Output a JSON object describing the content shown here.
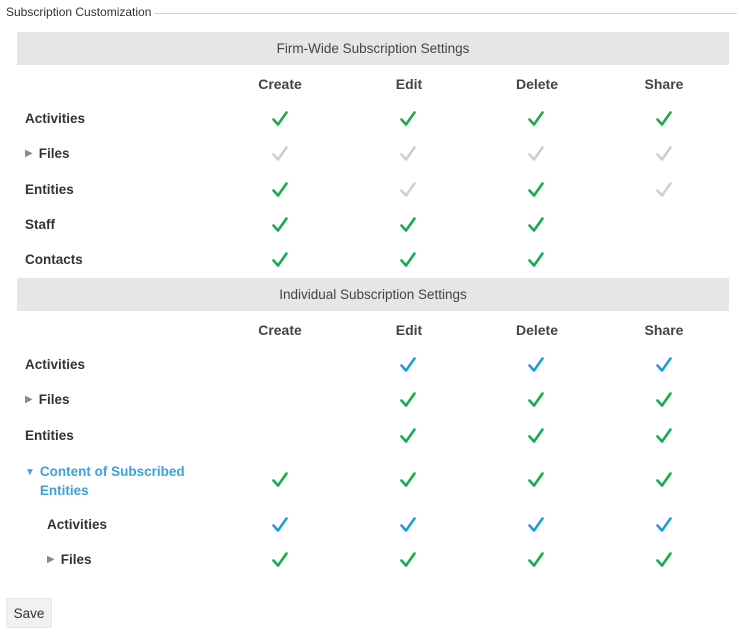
{
  "fieldset_title": "Subscription Customization",
  "colors": {
    "green": "#1aaa4e",
    "gray": "#d0d0d0",
    "blue": "#1a9ee0",
    "link": "#3aa3d9"
  },
  "firm": {
    "title": "Firm-Wide Subscription Settings",
    "headers": {
      "create": "Create",
      "edit": "Edit",
      "delete": "Delete",
      "share": "Share"
    },
    "rows": [
      {
        "label": "Activities",
        "create": "green",
        "edit": "green",
        "delete": "green",
        "share": "green"
      },
      {
        "label": "Files",
        "expander": "collapsed",
        "create": "gray",
        "edit": "gray",
        "delete": "gray",
        "share": "gray"
      },
      {
        "label": "Entities",
        "create": "green",
        "edit": "gray",
        "delete": "green",
        "share": "gray"
      },
      {
        "label": "Staff",
        "create": "green",
        "edit": "green",
        "delete": "green",
        "share": "none"
      },
      {
        "label": "Contacts",
        "create": "green",
        "edit": "green",
        "delete": "green",
        "share": "none"
      }
    ]
  },
  "individual": {
    "title": "Individual Subscription Settings",
    "headers": {
      "create": "Create",
      "edit": "Edit",
      "delete": "Delete",
      "share": "Share"
    },
    "rows": [
      {
        "label": "Activities",
        "create": "none",
        "edit": "blue",
        "delete": "blue",
        "share": "blue"
      },
      {
        "label": "Files",
        "expander": "collapsed",
        "create": "none",
        "edit": "green",
        "delete": "green",
        "share": "green"
      },
      {
        "label": "Entities",
        "create": "none",
        "edit": "green",
        "delete": "green",
        "share": "green"
      },
      {
        "label": "Content of Subscribed Entities",
        "expander": "expanded",
        "create": "green",
        "edit": "green",
        "delete": "green",
        "share": "green"
      },
      {
        "label": "Activities",
        "indent": true,
        "create": "blue",
        "edit": "blue",
        "delete": "blue",
        "share": "blue"
      },
      {
        "label": "Files",
        "indent": true,
        "expander": "collapsed",
        "create": "green",
        "edit": "green",
        "delete": "green",
        "share": "green"
      }
    ]
  },
  "save_label": "Save"
}
